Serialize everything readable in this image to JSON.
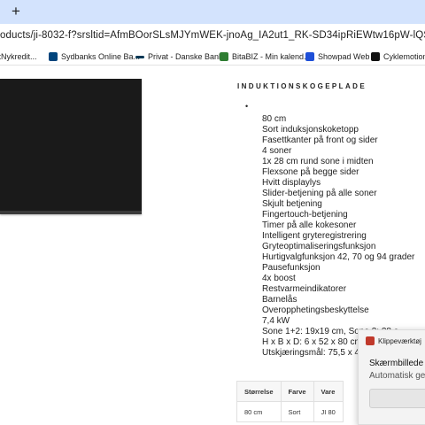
{
  "browser": {
    "new_tab_label": "+",
    "url": "oducts/ji-8032-f?srsltid=AfmBOorSLsMJYmWEK-jnoAg_IA2ut1_RK-SD34ipRiEWtw16pW-lQS_g",
    "bookmarks": [
      {
        "label": "ftNykredit...",
        "icon": "nykredit-icon",
        "color": "#0b3a6e"
      },
      {
        "label": "Sydbanks Online Ba...",
        "icon": "sydbank-icon",
        "color": "#00447c"
      },
      {
        "label": "Privat - Danske Bank",
        "icon": "danske-bank-icon",
        "color": "#003755"
      },
      {
        "label": "BitaBIZ - Min kalend...",
        "icon": "bitabiz-icon",
        "color": "#2e7d32"
      },
      {
        "label": "Showpad Web",
        "icon": "showpad-icon",
        "color": "#1e4fd8"
      },
      {
        "label": "Cyklemotion C",
        "icon": "cyklemotion-icon",
        "color": "#111111"
      }
    ]
  },
  "product": {
    "image_icon": "induction-hob-image",
    "heading": "INDUKTIONSKOGEPLADE",
    "empty_bullet": "•",
    "features": [
      "80 cm",
      "Sort induksjonskoketopp",
      "Fasettkanter på front og sider",
      "4 soner",
      "1x 28 cm rund sone i midten",
      "Flexsone på begge sider",
      "Hvitt displaylys",
      "Slider-betjening på alle soner",
      "Skjult betjening",
      "Fingertouch-betjening",
      "Timer på alle kokesoner",
      "Intelligent gryteregistrering",
      "Gryteoptimaliseringsfunksjon",
      "Hurtigvalgfunksjon 42, 70 og 94 grader",
      "Pausefunksjon",
      "4x boost",
      "Restvarmeindikatorer",
      "Barnelås",
      "Overopphetingsbeskyttelse",
      "7,4 kW",
      "Sone 1+2: 19x19 cm, Sone 3: 28 c",
      "H x B x D: 6 x 52 x 80 cm",
      "Utskjæringsmål: 75,5 x 49"
    ]
  },
  "spec_table": {
    "headers": [
      "Størrelse",
      "Farve",
      "Vare"
    ],
    "rows": [
      [
        "80 cm",
        "Sort",
        "JI 80"
      ]
    ]
  },
  "toast": {
    "app_name": "Klippeværktøj",
    "title": "Skærmbillede ko",
    "subtitle": "Automatisk gem"
  }
}
